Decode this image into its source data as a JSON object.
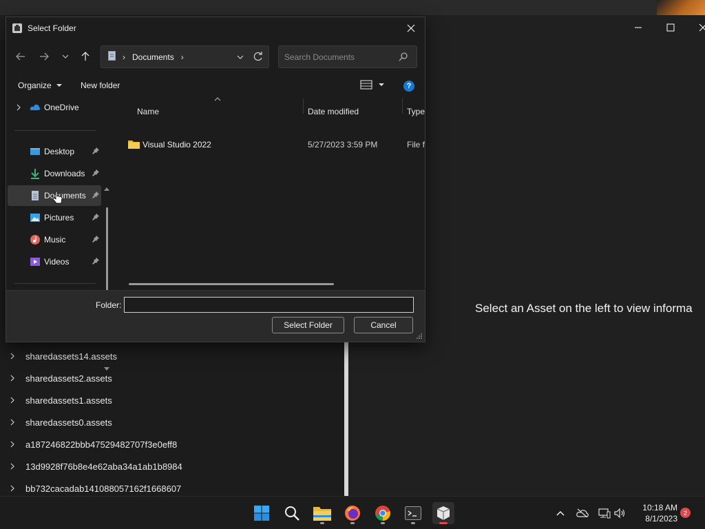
{
  "background_app": {
    "right_panel_message": "Select an Asset on the left to view informa",
    "tree_items": [
      "sharedassets14.assets",
      "sharedassets2.assets",
      "sharedassets1.assets",
      "sharedassets0.assets",
      "a187246822bbb47529482707f3e0eff8",
      "13d9928f76b8e4e62aba34a1ab1b8984",
      "bb732cacadab141088057162f1668607"
    ]
  },
  "dialog": {
    "title": "Select Folder",
    "address": {
      "crumb": "Documents",
      "separator": "›"
    },
    "search": {
      "placeholder": "Search Documents"
    },
    "commands": {
      "organize": "Organize",
      "new_folder": "New folder",
      "help": "?"
    },
    "nav_pane": {
      "onedrive": "OneDrive",
      "items": [
        {
          "label": "Desktop",
          "icon": "desktop-icon",
          "color": "#3a9ad9"
        },
        {
          "label": "Downloads",
          "icon": "download-icon",
          "color": "#3fb27f"
        },
        {
          "label": "Documents",
          "icon": "document-icon",
          "color": "#b8c4d6",
          "selected": true
        },
        {
          "label": "Pictures",
          "icon": "pictures-icon",
          "color": "#3aa0e0"
        },
        {
          "label": "Music",
          "icon": "music-icon",
          "color": "#e0685a"
        },
        {
          "label": "Videos",
          "icon": "videos-icon",
          "color": "#8a5cd6"
        }
      ]
    },
    "columns": {
      "name": "Name",
      "date_modified": "Date modified",
      "type": "Type"
    },
    "files": [
      {
        "name": "Visual Studio 2022",
        "date_modified": "5/27/2023 3:59 PM",
        "type": "File fo"
      }
    ],
    "folder_label": "Folder:",
    "folder_value": "",
    "select_button": "Select Folder",
    "cancel_button": "Cancel"
  },
  "taskbar": {
    "time": "10:18 AM",
    "date": "8/1/2023",
    "notification_count": "2"
  },
  "colors": {
    "accent": "#1b78d0",
    "folder": "#e8b93c",
    "selected_bg": "#383838"
  }
}
